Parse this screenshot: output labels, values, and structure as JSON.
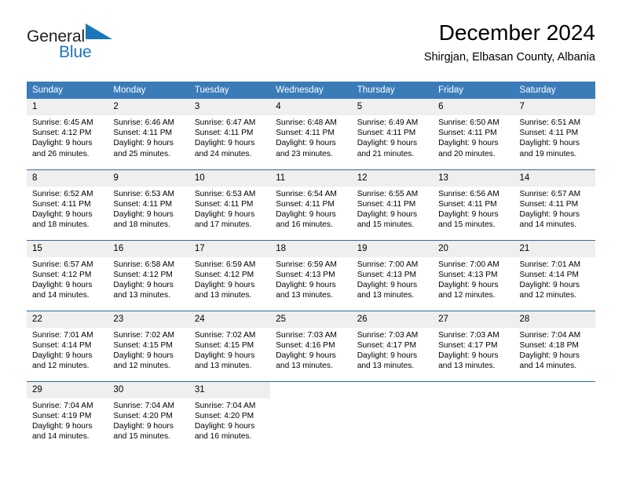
{
  "brand": {
    "line1": "General",
    "line2": "Blue",
    "flag_icon": "blue-triangle-flag-icon",
    "colors": {
      "dark": "#231f20",
      "blue": "#1b75bb"
    }
  },
  "header": {
    "title": "December 2024",
    "subtitle": "Shirgjan, Elbasan County, Albania"
  },
  "theme": {
    "header_bg": "#3a7cb8",
    "header_text": "#ffffff",
    "daynum_bg": "#efefef",
    "row_divider": "#2e6da4",
    "page_bg": "#ffffff"
  },
  "labels": {
    "sunrise_prefix": "Sunrise:",
    "sunset_prefix": "Sunset:",
    "daylight_prefix": "Daylight:"
  },
  "weekday_headers": [
    "Sunday",
    "Monday",
    "Tuesday",
    "Wednesday",
    "Thursday",
    "Friday",
    "Saturday"
  ],
  "weeks": [
    [
      {
        "day": "1",
        "sunrise": "Sunrise: 6:45 AM",
        "sunset": "Sunset: 4:12 PM",
        "daylight_line1": "Daylight: 9 hours",
        "daylight_line2": "and 26 minutes."
      },
      {
        "day": "2",
        "sunrise": "Sunrise: 6:46 AM",
        "sunset": "Sunset: 4:11 PM",
        "daylight_line1": "Daylight: 9 hours",
        "daylight_line2": "and 25 minutes."
      },
      {
        "day": "3",
        "sunrise": "Sunrise: 6:47 AM",
        "sunset": "Sunset: 4:11 PM",
        "daylight_line1": "Daylight: 9 hours",
        "daylight_line2": "and 24 minutes."
      },
      {
        "day": "4",
        "sunrise": "Sunrise: 6:48 AM",
        "sunset": "Sunset: 4:11 PM",
        "daylight_line1": "Daylight: 9 hours",
        "daylight_line2": "and 23 minutes."
      },
      {
        "day": "5",
        "sunrise": "Sunrise: 6:49 AM",
        "sunset": "Sunset: 4:11 PM",
        "daylight_line1": "Daylight: 9 hours",
        "daylight_line2": "and 21 minutes."
      },
      {
        "day": "6",
        "sunrise": "Sunrise: 6:50 AM",
        "sunset": "Sunset: 4:11 PM",
        "daylight_line1": "Daylight: 9 hours",
        "daylight_line2": "and 20 minutes."
      },
      {
        "day": "7",
        "sunrise": "Sunrise: 6:51 AM",
        "sunset": "Sunset: 4:11 PM",
        "daylight_line1": "Daylight: 9 hours",
        "daylight_line2": "and 19 minutes."
      }
    ],
    [
      {
        "day": "8",
        "sunrise": "Sunrise: 6:52 AM",
        "sunset": "Sunset: 4:11 PM",
        "daylight_line1": "Daylight: 9 hours",
        "daylight_line2": "and 18 minutes."
      },
      {
        "day": "9",
        "sunrise": "Sunrise: 6:53 AM",
        "sunset": "Sunset: 4:11 PM",
        "daylight_line1": "Daylight: 9 hours",
        "daylight_line2": "and 18 minutes."
      },
      {
        "day": "10",
        "sunrise": "Sunrise: 6:53 AM",
        "sunset": "Sunset: 4:11 PM",
        "daylight_line1": "Daylight: 9 hours",
        "daylight_line2": "and 17 minutes."
      },
      {
        "day": "11",
        "sunrise": "Sunrise: 6:54 AM",
        "sunset": "Sunset: 4:11 PM",
        "daylight_line1": "Daylight: 9 hours",
        "daylight_line2": "and 16 minutes."
      },
      {
        "day": "12",
        "sunrise": "Sunrise: 6:55 AM",
        "sunset": "Sunset: 4:11 PM",
        "daylight_line1": "Daylight: 9 hours",
        "daylight_line2": "and 15 minutes."
      },
      {
        "day": "13",
        "sunrise": "Sunrise: 6:56 AM",
        "sunset": "Sunset: 4:11 PM",
        "daylight_line1": "Daylight: 9 hours",
        "daylight_line2": "and 15 minutes."
      },
      {
        "day": "14",
        "sunrise": "Sunrise: 6:57 AM",
        "sunset": "Sunset: 4:11 PM",
        "daylight_line1": "Daylight: 9 hours",
        "daylight_line2": "and 14 minutes."
      }
    ],
    [
      {
        "day": "15",
        "sunrise": "Sunrise: 6:57 AM",
        "sunset": "Sunset: 4:12 PM",
        "daylight_line1": "Daylight: 9 hours",
        "daylight_line2": "and 14 minutes."
      },
      {
        "day": "16",
        "sunrise": "Sunrise: 6:58 AM",
        "sunset": "Sunset: 4:12 PM",
        "daylight_line1": "Daylight: 9 hours",
        "daylight_line2": "and 13 minutes."
      },
      {
        "day": "17",
        "sunrise": "Sunrise: 6:59 AM",
        "sunset": "Sunset: 4:12 PM",
        "daylight_line1": "Daylight: 9 hours",
        "daylight_line2": "and 13 minutes."
      },
      {
        "day": "18",
        "sunrise": "Sunrise: 6:59 AM",
        "sunset": "Sunset: 4:13 PM",
        "daylight_line1": "Daylight: 9 hours",
        "daylight_line2": "and 13 minutes."
      },
      {
        "day": "19",
        "sunrise": "Sunrise: 7:00 AM",
        "sunset": "Sunset: 4:13 PM",
        "daylight_line1": "Daylight: 9 hours",
        "daylight_line2": "and 13 minutes."
      },
      {
        "day": "20",
        "sunrise": "Sunrise: 7:00 AM",
        "sunset": "Sunset: 4:13 PM",
        "daylight_line1": "Daylight: 9 hours",
        "daylight_line2": "and 12 minutes."
      },
      {
        "day": "21",
        "sunrise": "Sunrise: 7:01 AM",
        "sunset": "Sunset: 4:14 PM",
        "daylight_line1": "Daylight: 9 hours",
        "daylight_line2": "and 12 minutes."
      }
    ],
    [
      {
        "day": "22",
        "sunrise": "Sunrise: 7:01 AM",
        "sunset": "Sunset: 4:14 PM",
        "daylight_line1": "Daylight: 9 hours",
        "daylight_line2": "and 12 minutes."
      },
      {
        "day": "23",
        "sunrise": "Sunrise: 7:02 AM",
        "sunset": "Sunset: 4:15 PM",
        "daylight_line1": "Daylight: 9 hours",
        "daylight_line2": "and 12 minutes."
      },
      {
        "day": "24",
        "sunrise": "Sunrise: 7:02 AM",
        "sunset": "Sunset: 4:15 PM",
        "daylight_line1": "Daylight: 9 hours",
        "daylight_line2": "and 13 minutes."
      },
      {
        "day": "25",
        "sunrise": "Sunrise: 7:03 AM",
        "sunset": "Sunset: 4:16 PM",
        "daylight_line1": "Daylight: 9 hours",
        "daylight_line2": "and 13 minutes."
      },
      {
        "day": "26",
        "sunrise": "Sunrise: 7:03 AM",
        "sunset": "Sunset: 4:17 PM",
        "daylight_line1": "Daylight: 9 hours",
        "daylight_line2": "and 13 minutes."
      },
      {
        "day": "27",
        "sunrise": "Sunrise: 7:03 AM",
        "sunset": "Sunset: 4:17 PM",
        "daylight_line1": "Daylight: 9 hours",
        "daylight_line2": "and 13 minutes."
      },
      {
        "day": "28",
        "sunrise": "Sunrise: 7:04 AM",
        "sunset": "Sunset: 4:18 PM",
        "daylight_line1": "Daylight: 9 hours",
        "daylight_line2": "and 14 minutes."
      }
    ],
    [
      {
        "day": "29",
        "sunrise": "Sunrise: 7:04 AM",
        "sunset": "Sunset: 4:19 PM",
        "daylight_line1": "Daylight: 9 hours",
        "daylight_line2": "and 14 minutes."
      },
      {
        "day": "30",
        "sunrise": "Sunrise: 7:04 AM",
        "sunset": "Sunset: 4:20 PM",
        "daylight_line1": "Daylight: 9 hours",
        "daylight_line2": "and 15 minutes."
      },
      {
        "day": "31",
        "sunrise": "Sunrise: 7:04 AM",
        "sunset": "Sunset: 4:20 PM",
        "daylight_line1": "Daylight: 9 hours",
        "daylight_line2": "and 16 minutes."
      },
      {
        "day": "",
        "sunrise": "",
        "sunset": "",
        "daylight_line1": "",
        "daylight_line2": ""
      },
      {
        "day": "",
        "sunrise": "",
        "sunset": "",
        "daylight_line1": "",
        "daylight_line2": ""
      },
      {
        "day": "",
        "sunrise": "",
        "sunset": "",
        "daylight_line1": "",
        "daylight_line2": ""
      },
      {
        "day": "",
        "sunrise": "",
        "sunset": "",
        "daylight_line1": "",
        "daylight_line2": ""
      }
    ]
  ]
}
